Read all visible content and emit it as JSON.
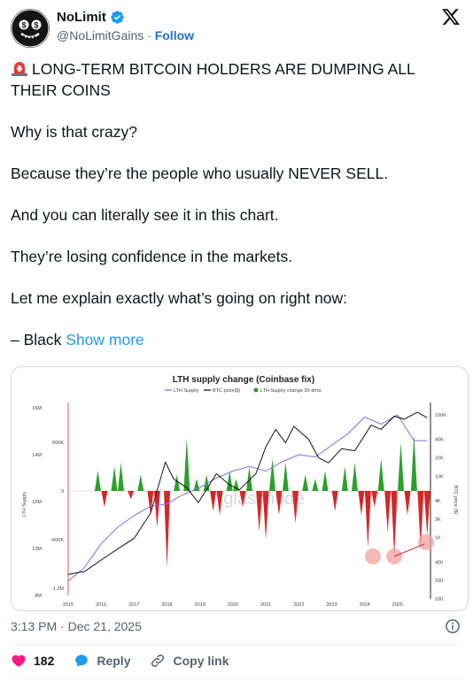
{
  "author": {
    "name": "NoLimit",
    "handle": "@NoLimitGains",
    "separator": "·",
    "follow_label": "Follow",
    "verified": true
  },
  "tweet": {
    "lines": [
      "LONG-TERM BITCOIN HOLDERS ARE DUMPING ALL THEIR COINS",
      "Why is that crazy?",
      "Because they’re the people who usually NEVER SELL.",
      "And you can literally see it in this chart.",
      "They’re losing confidence in the markets.",
      "Let me explain exactly what’s going on right now:",
      "– Black"
    ],
    "show_more": "Show more"
  },
  "chart_data": {
    "type": "bar",
    "title": "LTH supply change (Coinbase fix)",
    "legend": [
      "LTH Supply",
      "BTC price($)",
      "LTH Supply change 30-dma"
    ],
    "legend_position": "top-center",
    "x_ticks": [
      "2015",
      "2016",
      "2017",
      "2018",
      "2019",
      "2020",
      "2021",
      "2022",
      "2023",
      "2024",
      "2025"
    ],
    "y_left_ticks": [
      "16M",
      "14M",
      "12M",
      "10M",
      "8M"
    ],
    "y_change_ticks": [
      "600K",
      "0",
      "-600K",
      "-1.2M"
    ],
    "y_right_ticks": [
      "100K",
      "40K",
      "20K",
      "10K",
      "4K",
      "2K",
      "1K",
      "400",
      "200",
      "100"
    ],
    "y_left_label": "LTH Supply",
    "y_right_label": "BTC price ($)",
    "y_right_scale": "log",
    "watermark": "glassnode",
    "series": [
      {
        "name": "LTH Supply change 30-dma",
        "color": "#2ca02c",
        "negative_color": "#d62728",
        "x": [
          2015.9,
          2016.1,
          2016.4,
          2016.6,
          2016.9,
          2017.2,
          2017.5,
          2017.7,
          2018.0,
          2018.3,
          2018.6,
          2018.9,
          2019.2,
          2019.4,
          2019.6,
          2019.9,
          2020.1,
          2020.3,
          2020.5,
          2020.8,
          2021.0,
          2021.2,
          2021.4,
          2021.6,
          2021.9,
          2022.2,
          2022.5,
          2022.8,
          2023.1,
          2023.4,
          2023.7,
          2023.9,
          2024.1,
          2024.3,
          2024.5,
          2024.7,
          2024.9,
          2025.1,
          2025.3,
          2025.5,
          2025.7,
          2025.9
        ],
        "y": [
          250000,
          -200000,
          300000,
          350000,
          -100000,
          200000,
          -300000,
          -450000,
          -950000,
          200000,
          650000,
          150000,
          200000,
          -250000,
          -300000,
          250000,
          150000,
          -200000,
          300000,
          -500000,
          -600000,
          400000,
          -300000,
          350000,
          -400000,
          200000,
          150000,
          250000,
          -250000,
          300000,
          350000,
          -300000,
          -700000,
          -200000,
          400000,
          -500000,
          -800000,
          600000,
          -300000,
          700000,
          -700000,
          -550000
        ]
      },
      {
        "name": "LTH Supply",
        "color": "#7b6fe0",
        "x": [
          2015.0,
          2015.5,
          2016.0,
          2016.5,
          2017.0,
          2017.5,
          2018.0,
          2018.5,
          2019.0,
          2019.5,
          2020.0,
          2020.5,
          2021.0,
          2021.5,
          2022.0,
          2022.5,
          2023.0,
          2023.5,
          2024.0,
          2024.5,
          2025.0,
          2025.5,
          2025.9
        ],
        "y": [
          8.6,
          9.2,
          10.2,
          10.9,
          11.4,
          11.8,
          11.9,
          12.3,
          12.6,
          13.0,
          13.3,
          13.5,
          13.3,
          13.7,
          14.0,
          13.9,
          14.4,
          14.9,
          15.6,
          15.3,
          15.7,
          14.6,
          14.6
        ]
      },
      {
        "name": "BTC price($)",
        "color": "#111111",
        "x": [
          2015.0,
          2015.5,
          2016.0,
          2016.5,
          2017.0,
          2017.5,
          2017.95,
          2018.2,
          2018.6,
          2018.95,
          2019.5,
          2019.9,
          2020.2,
          2020.7,
          2021.0,
          2021.3,
          2021.6,
          2021.85,
          2022.3,
          2022.6,
          2022.9,
          2023.3,
          2023.7,
          2024.2,
          2024.5,
          2024.9,
          2025.2,
          2025.6,
          2025.9
        ],
        "y": [
          250,
          280,
          430,
          650,
          970,
          2500,
          17000,
          9000,
          6500,
          3700,
          11000,
          7200,
          6000,
          11000,
          30000,
          58000,
          35000,
          65000,
          40000,
          20000,
          16500,
          28000,
          26000,
          68000,
          58000,
          95000,
          85000,
          110000,
          90000
        ]
      }
    ]
  },
  "timestamp": "3:13 PM · Dec 21, 2025",
  "actions": {
    "likes": "182",
    "reply": "Reply",
    "copy_link": "Copy link"
  }
}
